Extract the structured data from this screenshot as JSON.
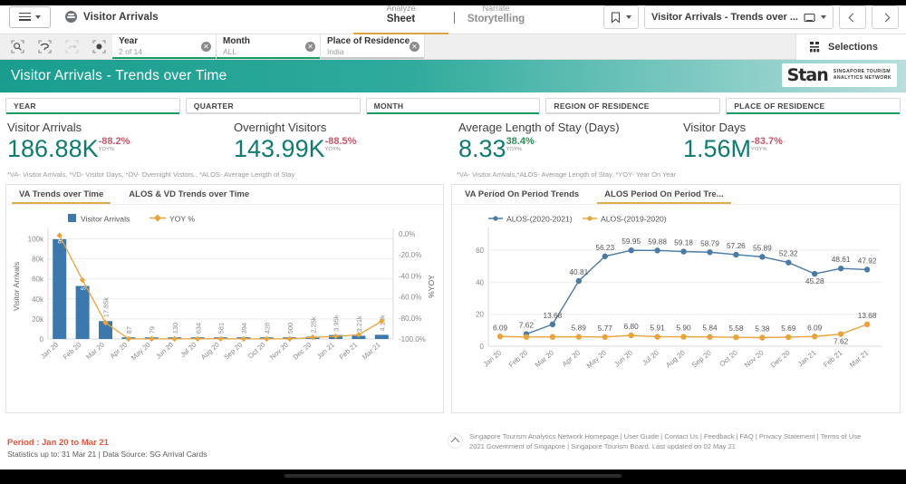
{
  "appbar": {
    "menu_icon": "hamburger-icon",
    "app_title": "Visitor Arrivals",
    "modes": [
      {
        "top": "Analyze",
        "bottom": "Sheet",
        "active": true
      },
      {
        "top": "Narrate",
        "bottom": "Storytelling",
        "active": false
      }
    ],
    "bookmark_icon": "bookmark-icon",
    "sheet_name": "Visitor Arrivals - Trends over ...",
    "prev_icon": "chevron-left-icon",
    "next_icon": "chevron-right-icon"
  },
  "selbar": {
    "tools": [
      "selection-search-icon",
      "lasso-select-icon",
      "step-back-icon",
      "clear-selections-icon"
    ],
    "chips": [
      {
        "name": "Year",
        "value": "2 of 14",
        "state": "green"
      },
      {
        "name": "Month",
        "value": "ALL",
        "state": "green"
      },
      {
        "name": "Place of Residence",
        "value": "India",
        "state": "grey"
      }
    ],
    "selections_label": "Selections",
    "selections_icon": "selections-grid-icon"
  },
  "dashboard": {
    "title": "Visitor Arrivals - Trends over Time",
    "logo_text": "Stan",
    "logo_sub_line1": "SINGAPORE  TOURISM",
    "logo_sub_line2": "ANALYTICS  NETWORK"
  },
  "filters": [
    {
      "label": "YEAR",
      "selected": true
    },
    {
      "label": "QUARTER",
      "selected": false
    },
    {
      "label": "MONTH",
      "selected": true
    },
    {
      "label": "REGION OF RESIDENCE",
      "selected": false
    },
    {
      "label": "PLACE OF RESIDENCE",
      "selected": true
    }
  ],
  "kpis": [
    {
      "label": "Visitor Arrivals",
      "value": "186.88K",
      "pct": "-88.2%",
      "pct_sign": "neg",
      "unit": "YOY%"
    },
    {
      "label": "Overnight Visitors",
      "value": "143.99K",
      "pct": "-88.5%",
      "pct_sign": "neg",
      "unit": "YOY%"
    },
    {
      "label": "Average Length of Stay (Days)",
      "value": "8.33",
      "pct": "38.4%",
      "pct_sign": "pos",
      "unit": "YOY%"
    },
    {
      "label": "Visitor Days",
      "value": "1.56M",
      "pct": "-83.7%",
      "pct_sign": "neg",
      "unit": "YOY%"
    }
  ],
  "notes": {
    "left": "*VA- Visitor Arrivals, *VD- Visitor Days, *OV- Overnight Vistors , *ALOS- Average Length of Stay",
    "right": "*VA- Visitor Arrivals,*ALOS- Average Length of Stay, *YOY- Year On Year"
  },
  "left_panel": {
    "tabs": [
      {
        "label": "VA Trends over Time",
        "active": true
      },
      {
        "label": "ALOS & VD Trends over Time",
        "active": false
      }
    ]
  },
  "right_panel": {
    "tabs": [
      {
        "label": "VA Period On Period Trends",
        "active": false
      },
      {
        "label": "ALOS Period On Period Tre...",
        "active": true
      }
    ]
  },
  "footer_left": {
    "period": "Period : Jan 20 to Mar 21",
    "stats": "Statistics up to: 31 Mar 21 | Data Source: SG Arrival Cards"
  },
  "footer_right": {
    "scroll_top_icon": "scroll-to-top-icon",
    "line1": "Singapore Tourism Analytics Network Homepage | User Guide | Contact Us | Feedback | FAQ | Privacy Statement | Terms of Use",
    "line2": "2021 Government of Singapore | Singapore Tourism Board. Last updated on 02 May 21"
  },
  "chart_data": [
    {
      "id": "va_trends",
      "type": "bar",
      "title": "VA Trends over Time",
      "xlabel": "",
      "ylabel": "Visitor Arrivals",
      "y2label": "%YOY",
      "categories": [
        "Jan 20",
        "Feb 20",
        "Mar 20",
        "Apr 20",
        "May 20",
        "Jun 20",
        "Jul 20",
        "Aug 20",
        "Sep 20",
        "Oct 20",
        "Nov 20",
        "Dec 20",
        "Jan 21",
        "Feb 21",
        "Mar 21"
      ],
      "ylim": [
        0,
        100000
      ],
      "yticks": [
        "0",
        "20k",
        "40k",
        "60k",
        "80k",
        "100k"
      ],
      "y2lim": [
        -100,
        0
      ],
      "y2ticks": [
        "0.0%",
        "-20.0%",
        "-40.0%",
        "-60.0%",
        "-80.0%",
        "-100.0%"
      ],
      "legend": [
        {
          "name": "Visitor Arrivals",
          "color": "#3c77ad",
          "marker": "square"
        },
        {
          "name": "YOY %",
          "color": "#e8a33d",
          "marker": "line-diamond"
        }
      ],
      "series": [
        {
          "name": "Visitor Arrivals",
          "color": "#3c77ad",
          "axis": "left",
          "values": [
            99640,
            52950,
            17850,
            87,
            79,
            130,
            634,
            581,
            394,
            428,
            500,
            2250,
            3950,
            3210,
            4190
          ],
          "labels": [
            "99.64k",
            "52.95k",
            "17.85k",
            "87",
            "79",
            "130",
            "634",
            "581",
            "394",
            "428",
            "500",
            "2.25k",
            "3.95k",
            "3.21k",
            "4.19k"
          ]
        },
        {
          "name": "YOY %",
          "color": "#e8a33d",
          "axis": "right",
          "values": [
            -1.5,
            -44.0,
            -84.5,
            -99.9,
            -99.9,
            -99.9,
            -99.8,
            -99.8,
            -99.9,
            -99.9,
            -99.9,
            -98.5,
            -97.5,
            -96.0,
            -83.0
          ]
        }
      ]
    },
    {
      "id": "alos_pop",
      "type": "line",
      "title": "ALOS Period On Period Trends",
      "xlabel": "",
      "ylabel": "",
      "categories": [
        "Jan 20",
        "Feb 20",
        "Mar 20",
        "Apr 20",
        "May 20",
        "Jun 20",
        "Jul 20",
        "Aug 20",
        "Sep 20",
        "Oct 20",
        "Nov 20",
        "Dec 20",
        "Jan 21",
        "Feb 21",
        "Mar 21"
      ],
      "ylim": [
        0,
        66
      ],
      "yticks": [
        "0",
        "20",
        "40",
        "60"
      ],
      "legend": [
        {
          "name": "ALOS-(2020-2021)",
          "color": "#4a7ba7"
        },
        {
          "name": "ALOS-(2019-2020)",
          "color": "#e8a33d"
        }
      ],
      "series": [
        {
          "name": "ALOS-(2020-2021)",
          "color": "#4a7ba7",
          "values": [
            null,
            7.62,
            13.68,
            40.81,
            56.23,
            59.95,
            59.88,
            59.18,
            58.79,
            57.26,
            55.89,
            52.32,
            45.28,
            48.61,
            47.92
          ],
          "labels": [
            null,
            "7.62",
            "13.68",
            "40.81",
            "56.23",
            "59.95",
            "59.88",
            "59.18",
            "58.79",
            "57.26",
            "55.89",
            "52.32",
            "45.28",
            "48.61",
            "47.92"
          ]
        },
        {
          "name": "ALOS-(2019-2020)",
          "color": "#e8a33d",
          "values": [
            6.09,
            5.8,
            5.85,
            5.89,
            5.77,
            6.8,
            5.91,
            5.9,
            5.84,
            5.58,
            5.38,
            5.69,
            6.09,
            7.62,
            13.68
          ],
          "labels": [
            "6.09",
            null,
            null,
            "5.89",
            "5.77",
            "6.80",
            "5.91",
            "5.90",
            "5.84",
            "5.58",
            "5.38",
            "5.69",
            "6.09",
            "7.62",
            "13.68"
          ]
        }
      ]
    }
  ]
}
